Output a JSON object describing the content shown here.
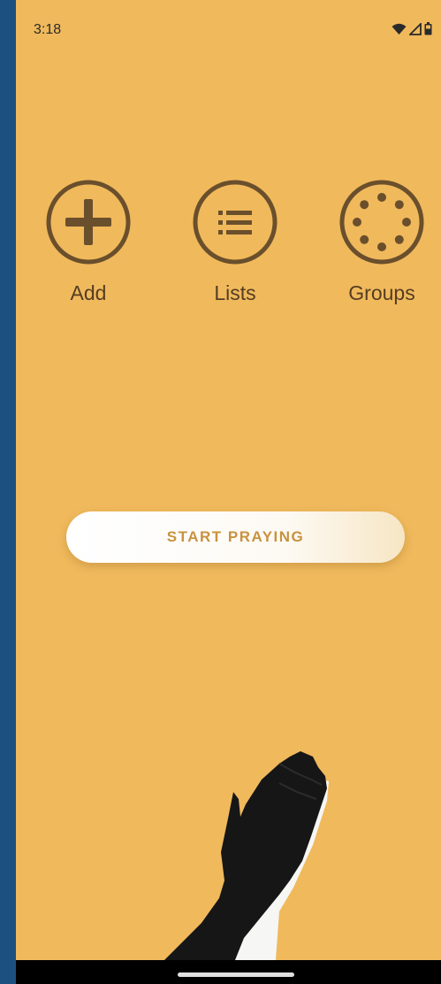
{
  "status_bar": {
    "time": "3:18",
    "icons": [
      "wifi-icon",
      "cellular-signal-icon",
      "battery-icon"
    ]
  },
  "actions": [
    {
      "label": "Add",
      "icon": "plus-circle-icon"
    },
    {
      "label": "Lists",
      "icon": "list-circle-icon"
    },
    {
      "label": "Groups",
      "icon": "group-circle-icon"
    }
  ],
  "start_button": {
    "label": "START PRAYING"
  },
  "illustration": {
    "icon": "praying-hands-icon"
  },
  "colors": {
    "background": "#f0b95c",
    "icon_brown": "#6a4f2c",
    "button_text": "#c7923f",
    "outer_frame": "#1c5080"
  }
}
